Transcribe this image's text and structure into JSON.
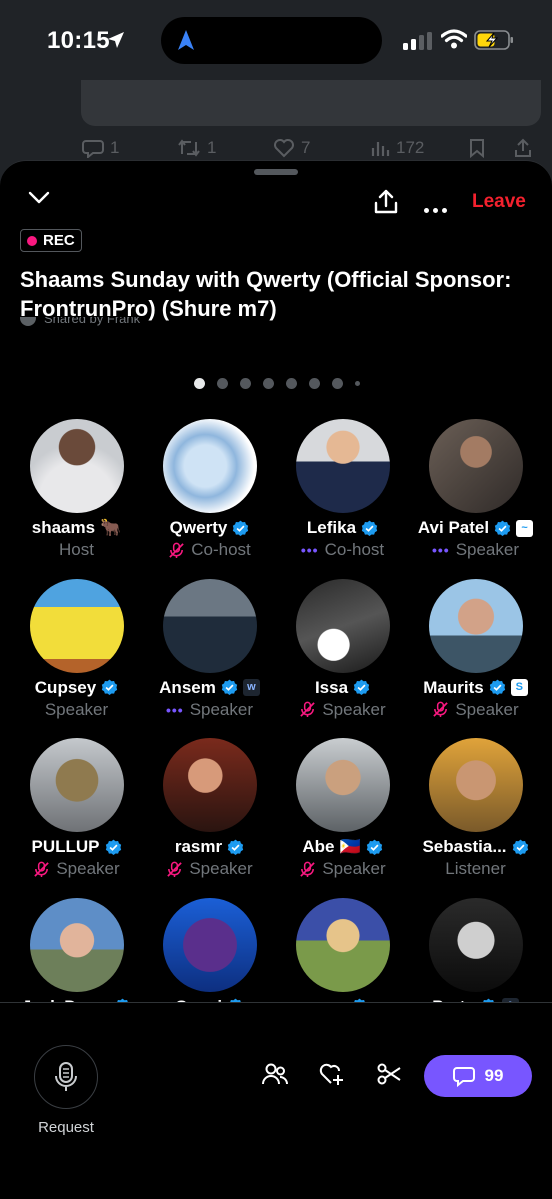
{
  "status_bar": {
    "time": "10:15"
  },
  "feed": {
    "replies": "1",
    "reposts": "1",
    "likes": "7",
    "views": "172"
  },
  "space": {
    "rec_label": "REC",
    "title": "Shaams Sunday with Qwerty (Official Sponsor: FrontrunPro) (Shure m7)",
    "shared_by": "Shared by Frank",
    "leave_label": "Leave",
    "page_count": 8,
    "active_page": 1
  },
  "participants": [
    {
      "name": "shaams",
      "suffix": "🐂",
      "verified": false,
      "role": "Host",
      "status": "none",
      "badge": ""
    },
    {
      "name": "Qwerty",
      "suffix": "",
      "verified": true,
      "role": "Co-host",
      "status": "muted",
      "badge": ""
    },
    {
      "name": "Lefika",
      "suffix": "",
      "verified": true,
      "role": "Co-host",
      "status": "talking",
      "badge": ""
    },
    {
      "name": "Avi Patel",
      "suffix": "",
      "verified": true,
      "role": "Speaker",
      "status": "talking",
      "badge": "~"
    },
    {
      "name": "Cupsey",
      "suffix": "",
      "verified": true,
      "role": "Speaker",
      "status": "none",
      "badge": ""
    },
    {
      "name": "Ansem",
      "suffix": "",
      "verified": true,
      "role": "Speaker",
      "status": "talking",
      "badge": "w"
    },
    {
      "name": "Issa",
      "suffix": "",
      "verified": true,
      "role": "Speaker",
      "status": "muted",
      "badge": ""
    },
    {
      "name": "Maurits",
      "suffix": "",
      "verified": true,
      "role": "Speaker",
      "status": "muted",
      "badge": "S"
    },
    {
      "name": "PULLUP",
      "suffix": "",
      "verified": true,
      "role": "Speaker",
      "status": "muted",
      "badge": ""
    },
    {
      "name": "rasmr",
      "suffix": "",
      "verified": true,
      "role": "Speaker",
      "status": "muted",
      "badge": ""
    },
    {
      "name": "Abe",
      "suffix": "🇵🇭",
      "verified": true,
      "role": "Speaker",
      "status": "muted",
      "badge": ""
    },
    {
      "name": "Sebastia...",
      "suffix": "",
      "verified": true,
      "role": "Listener",
      "status": "none",
      "badge": ""
    },
    {
      "name": "Jack Duv...",
      "suffix": "",
      "verified": true,
      "role": "",
      "status": "none",
      "badge": ""
    },
    {
      "name": "Qwari",
      "suffix": "",
      "verified": true,
      "role": "",
      "status": "none",
      "badge": ""
    },
    {
      "name": "can",
      "suffix": "",
      "verified": true,
      "role": "",
      "status": "none",
      "badge": ""
    },
    {
      "name": "Parta",
      "suffix": "",
      "verified": true,
      "role": "",
      "status": "none",
      "badge": "A"
    }
  ],
  "bottom_bar": {
    "request_label": "Request",
    "chat_count": "99"
  },
  "colors": {
    "accent": "#7856ff",
    "leave": "#f4212e",
    "verified": "#1d9bf0",
    "rec_dot": "#f91880",
    "muted": "#f91880"
  }
}
